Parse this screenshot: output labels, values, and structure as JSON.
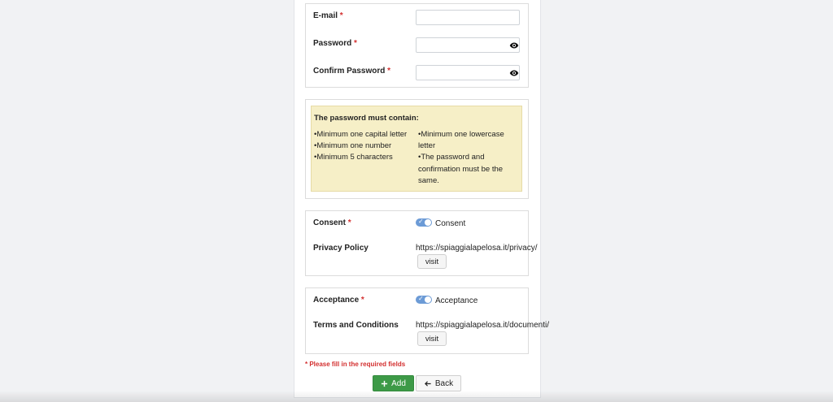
{
  "credentials": {
    "email_label": "E-mail",
    "email_value": "",
    "password_label": "Password",
    "password_value": "",
    "confirm_label": "Confirm Password",
    "confirm_value": "",
    "required_mark": "*"
  },
  "password_rules": {
    "title": "The password must contain:",
    "rules_col1": [
      "•Minimum one capital letter",
      "•Minimum one number",
      "•Minimum 5 characters"
    ],
    "rules_col2": [
      "•Minimum one lowercase letter",
      "•The password and confirmation must be the same."
    ]
  },
  "consent": {
    "label": "Consent",
    "toggle_label": "Consent",
    "toggle_on": true,
    "policy_label": "Privacy Policy",
    "policy_url": "https://spiaggialapelosa.it/privacy/",
    "visit_label": "visit"
  },
  "acceptance": {
    "label": "Acceptance",
    "toggle_label": "Acceptance",
    "toggle_on": true,
    "terms_label": "Terms and Conditions",
    "terms_url": "https://spiaggialapelosa.it/documenti/",
    "visit_label": "visit"
  },
  "form": {
    "required_note": "* Please fill in the required fields",
    "add_label": "Add",
    "back_label": "Back"
  },
  "icons": {
    "password_visibility": "eye-icon",
    "add": "plus-icon",
    "back": "arrow-left-icon"
  },
  "colors": {
    "accent_green": "#3d9a47",
    "required_red": "#d32f2f",
    "notice_bg": "#f6efc7",
    "toggle_blue": "#6c9bd6"
  }
}
